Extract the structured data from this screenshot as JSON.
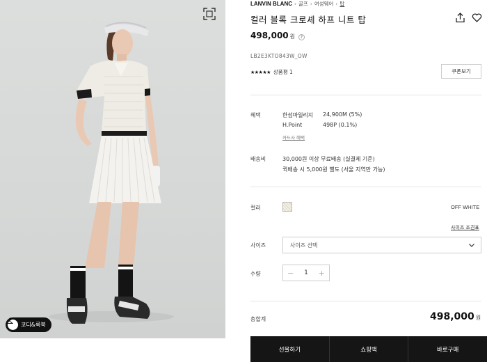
{
  "breadcrumb": {
    "brand": "LANVIN BLANC",
    "items": [
      "골프",
      "여성웨어",
      "탑"
    ]
  },
  "product": {
    "title": "컬러 블록 크로셰 하프 니트 탑",
    "price": "498,000",
    "price_unit": "원",
    "code": "LB2E3KTO843W_OW",
    "stars": "★★★★★",
    "review_label": "상품평 1",
    "coupon_label": "쿠폰보기"
  },
  "benefits": {
    "label": "혜택",
    "rows": [
      {
        "name": "한섬마일리지",
        "value": "24,900M (5%)"
      },
      {
        "name": "H.Point",
        "value": "498P (0.1%)"
      }
    ],
    "card_link": "카드사 혜택"
  },
  "shipping": {
    "label": "배송비",
    "line1": "30,000원 이상 무료배송 (실결제 기준)",
    "line2": "퀵배송 시 5,000원 별도 (서울 지역만 가능)"
  },
  "color": {
    "label": "컬러",
    "name": "OFF WHITE",
    "size_guide": "사이즈 조견표"
  },
  "size": {
    "label": "사이즈",
    "placeholder": "사이즈 선택"
  },
  "quantity": {
    "label": "수량",
    "minus": "−",
    "value": "1",
    "plus": "+"
  },
  "total": {
    "label": "총합계",
    "value": "498,000",
    "unit": "원"
  },
  "actions": {
    "gift": "선물하기",
    "bag": "쇼핑백",
    "buy": "바로구매"
  },
  "image_panel": {
    "codi_label": "코디&룩북"
  },
  "icons": {
    "zoom": "expand-icon",
    "share": "share-icon",
    "wishlist": "heart-icon",
    "chevron": "chevron-down-icon"
  }
}
